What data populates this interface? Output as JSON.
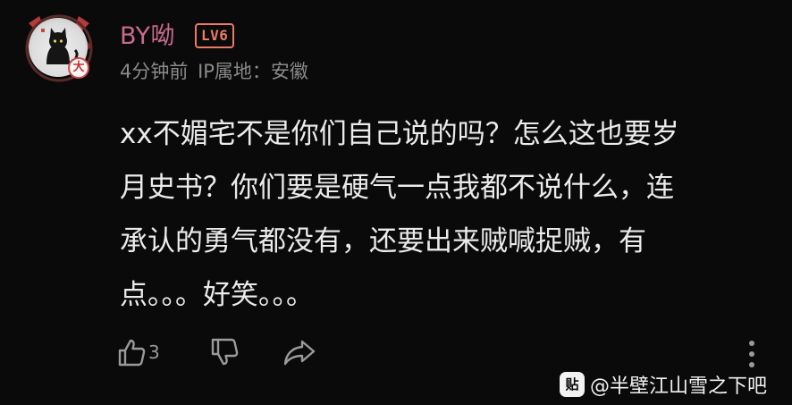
{
  "comment": {
    "author": {
      "username": "BY呦",
      "level": "LV6",
      "avatar_badge": "大"
    },
    "meta": {
      "time_ago": "4分钟前",
      "ip_location": "IP属地：安徽"
    },
    "text_lines": [
      "xx不媚宅不是你们自己说的吗？怎么这也要岁",
      "月史书？你们要是硬气一点我都不说什么，连",
      "承认的勇气都没有，还要出来贼喊捉贼，有",
      "点。。。好笑。。。"
    ],
    "actions": {
      "like_icon": "thumbs-up-icon",
      "like_count": "3",
      "dislike_icon": "thumbs-down-icon",
      "share_icon": "share-arrow-icon",
      "more_icon": "vertical-dots-icon"
    }
  },
  "watermark": {
    "logo_text": "贴",
    "text": "@半壁江山雪之下吧"
  },
  "colors": {
    "background": "#0a0a0a",
    "username": "#c96a8e",
    "level_badge": "#ec7a63",
    "meta_text": "#8a8a8a",
    "body_text": "#ebebeb",
    "icon": "#9a9a9a"
  }
}
